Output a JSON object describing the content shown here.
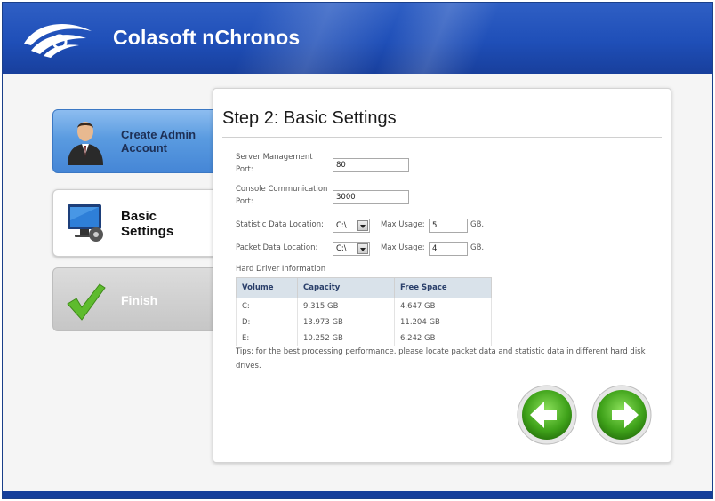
{
  "app": {
    "title": "Colasoft nChronos"
  },
  "steps": [
    {
      "label": "Create Admin\nAccount",
      "state": "completed"
    },
    {
      "label": "Basic\nSettings",
      "state": "current"
    },
    {
      "label": "Finish",
      "state": "pending"
    }
  ],
  "page": {
    "title": "Step 2: Basic Settings"
  },
  "form": {
    "server_port": {
      "label": "Server Management\nPort:",
      "value": "80"
    },
    "console_port": {
      "label": "Console Communication\nPort:",
      "value": "3000"
    },
    "statistic": {
      "label": "Statistic Data Location:",
      "drive": "C:\\",
      "max_label": "Max Usage:",
      "max_value": "5",
      "unit": "GB."
    },
    "packet": {
      "label": "Packet Data Location:",
      "drive": "C:\\",
      "max_label": "Max Usage:",
      "max_value": "4",
      "unit": "GB."
    }
  },
  "hard_drives": {
    "section_label": "Hard Driver Information",
    "columns": [
      "Volume",
      "Capacity",
      "Free Space"
    ],
    "rows": [
      [
        "C:",
        "9.315 GB",
        "4.647 GB"
      ],
      [
        "D:",
        "13.973 GB",
        "11.204 GB"
      ],
      [
        "E:",
        "10.252 GB",
        "6.242 GB"
      ]
    ]
  },
  "tips": "Tips: for the best processing performance, please locate packet data and statistic data in different hard disk drives.",
  "nav": {
    "back_icon": "arrow-left-icon",
    "next_icon": "arrow-right-icon"
  },
  "colors": {
    "header": "#1f4fb8",
    "accent_blue": "#4586d6",
    "nav_green": "#4caf27"
  }
}
